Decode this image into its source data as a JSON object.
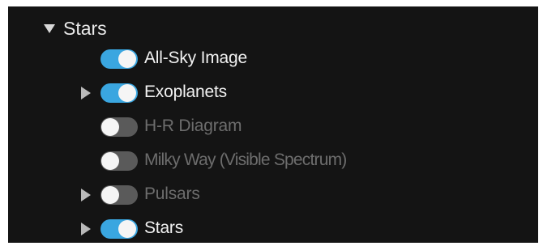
{
  "header": {
    "title": "Stars",
    "caret_icon": "triangle-down-icon"
  },
  "items": [
    {
      "label": "All-Sky Image",
      "enabled": true,
      "expandable": false
    },
    {
      "label": "Exoplanets",
      "enabled": true,
      "expandable": true
    },
    {
      "label": "H-R Diagram",
      "enabled": false,
      "expandable": false
    },
    {
      "label": "Milky Way (Visible Spectrum)",
      "enabled": false,
      "expandable": false
    },
    {
      "label": "Pulsars",
      "enabled": false,
      "expandable": true
    },
    {
      "label": "Stars",
      "enabled": true,
      "expandable": true
    }
  ],
  "colors": {
    "background": "#141414",
    "toggle_on": "#3aa6e0",
    "toggle_off": "#5a5a5a",
    "text_enabled": "#f2f2f2",
    "text_disabled": "#6d6d6d"
  }
}
